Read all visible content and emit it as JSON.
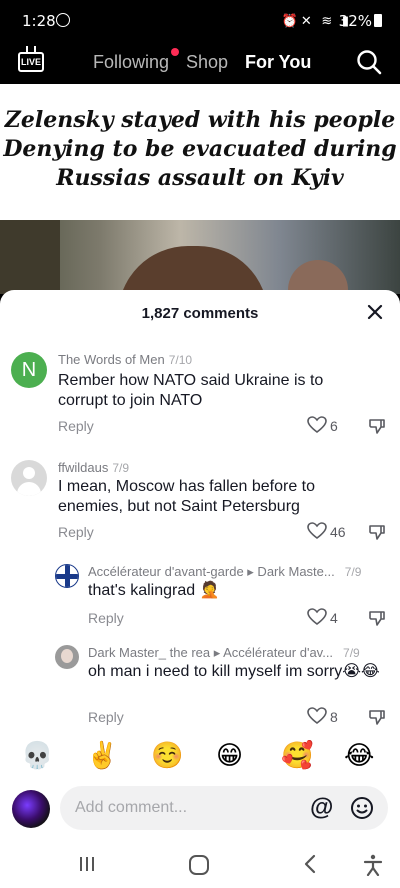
{
  "status_bar": {
    "time": "1:28",
    "battery": "32%"
  },
  "nav": {
    "live_label": "LIVE",
    "tabs": [
      "Following",
      "Shop",
      "For You"
    ]
  },
  "video": {
    "headline_lines": [
      "Zelensky stayed with his people",
      "Denying to be evacuated during",
      "Russias assault on Kyiv"
    ]
  },
  "comments_sheet": {
    "title": "1,827 comments",
    "reply_label": "Reply",
    "comments": [
      {
        "avatar_letter": "N",
        "username": "The Words of Men",
        "date": "7/10",
        "text": "Rember how NATO said Ukraine is to corrupt to join NATO",
        "likes": "6"
      },
      {
        "username": "ffwildaus",
        "date": "7/9",
        "text": "I mean, Moscow has fallen before to enemies, but not Saint Petersburg",
        "likes": "46"
      }
    ],
    "replies": [
      {
        "username": "Accélérateur d'avant-garde ▸ Dark Maste...",
        "date": "7/9",
        "text": "that's kalingrad 🤦",
        "likes": "4"
      },
      {
        "username": "Dark Master_ the rea ▸ Accélérateur d'av...",
        "date": "7/9",
        "text": "oh man i need to kill myself im sorry😭😂",
        "likes": "8"
      }
    ]
  },
  "emoji_bar": [
    "💀",
    "✌️",
    "☺️",
    "😁",
    "🥰",
    "😂"
  ],
  "comment_input": {
    "placeholder": "Add comment..."
  },
  "colors": {
    "accent": "#fe2c55",
    "avatar_green": "#4caf50"
  }
}
